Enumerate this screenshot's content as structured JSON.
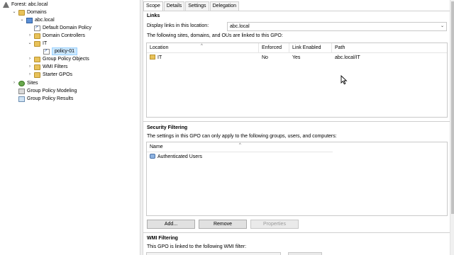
{
  "tree": {
    "forest": "Forest: abc.local",
    "domains": "Domains",
    "domain": "abc.local",
    "default_policy": "Default Domain Policy",
    "domain_controllers": "Domain Controllers",
    "it": "IT",
    "policy": "policy-01",
    "gpo_objects": "Group Policy Objects",
    "wmi_filters": "WMI Filters",
    "starter_gpos": "Starter GPOs",
    "sites": "Sites",
    "modeling": "Group Policy Modeling",
    "results": "Group Policy Results"
  },
  "tabs": [
    "Scope",
    "Details",
    "Settings",
    "Delegation"
  ],
  "links": {
    "title": "Links",
    "display_label": "Display links in this location:",
    "location_value": "abc.local",
    "note": "The following sites, domains, and OUs are linked to this GPO:",
    "columns": [
      "Location",
      "Enforced",
      "Link Enabled",
      "Path"
    ],
    "rows": [
      {
        "location": "IT",
        "enforced": "No",
        "link_enabled": "Yes",
        "path": "abc.local/IT"
      }
    ]
  },
  "security": {
    "title": "Security Filtering",
    "note": "The settings in this GPO can only apply to the following groups, users, and computers:",
    "column": "Name",
    "rows": [
      "Authenticated Users"
    ],
    "add_label": "Add...",
    "remove_label": "Remove",
    "properties_label": "Properties"
  },
  "wmi": {
    "title": "WMI Filtering",
    "note": "This GPO is linked to the following WMI filter:"
  }
}
